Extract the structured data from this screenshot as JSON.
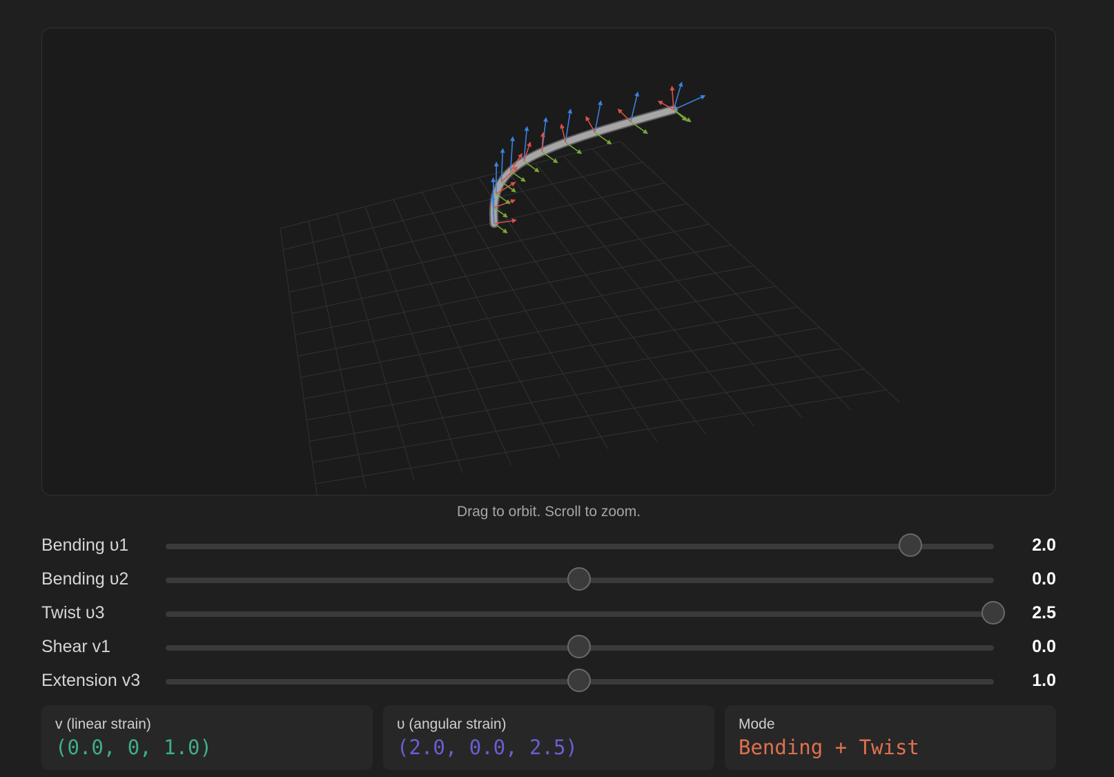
{
  "viewport": {
    "hint": "Drag to orbit. Scroll to zoom."
  },
  "sliders": [
    {
      "id": "bending-u1",
      "label": "Bending υ1",
      "value": 2.0,
      "display": "2.0",
      "min": -2.5,
      "max": 2.5
    },
    {
      "id": "bending-u2",
      "label": "Bending υ2",
      "value": 0.0,
      "display": "0.0",
      "min": -2.5,
      "max": 2.5
    },
    {
      "id": "twist-u3",
      "label": "Twist υ3",
      "value": 2.5,
      "display": "2.5",
      "min": -2.5,
      "max": 2.5
    },
    {
      "id": "shear-v1",
      "label": "Shear v1",
      "value": 0.0,
      "display": "0.0",
      "min": -1.0,
      "max": 1.0
    },
    {
      "id": "extension-v3",
      "label": "Extension v3",
      "value": 1.0,
      "display": "1.0",
      "min": 0.5,
      "max": 1.5
    }
  ],
  "cards": {
    "linear": {
      "label": "v (linear strain)",
      "value": "(0.0, 0, 1.0)",
      "color": "#3fae8c"
    },
    "angular": {
      "label": "υ (angular strain)",
      "value": "(2.0, 0.0, 2.5)",
      "color": "#6a5fd3"
    },
    "mode": {
      "label": "Mode",
      "value": "Bending + Twist",
      "color": "#e0704f"
    }
  },
  "colors": {
    "axis_x": "#d9524a",
    "axis_y": "#7aa83a",
    "axis_z": "#3b82e0",
    "rod": "#a6a6a6",
    "grid": "#2f2f2f"
  }
}
